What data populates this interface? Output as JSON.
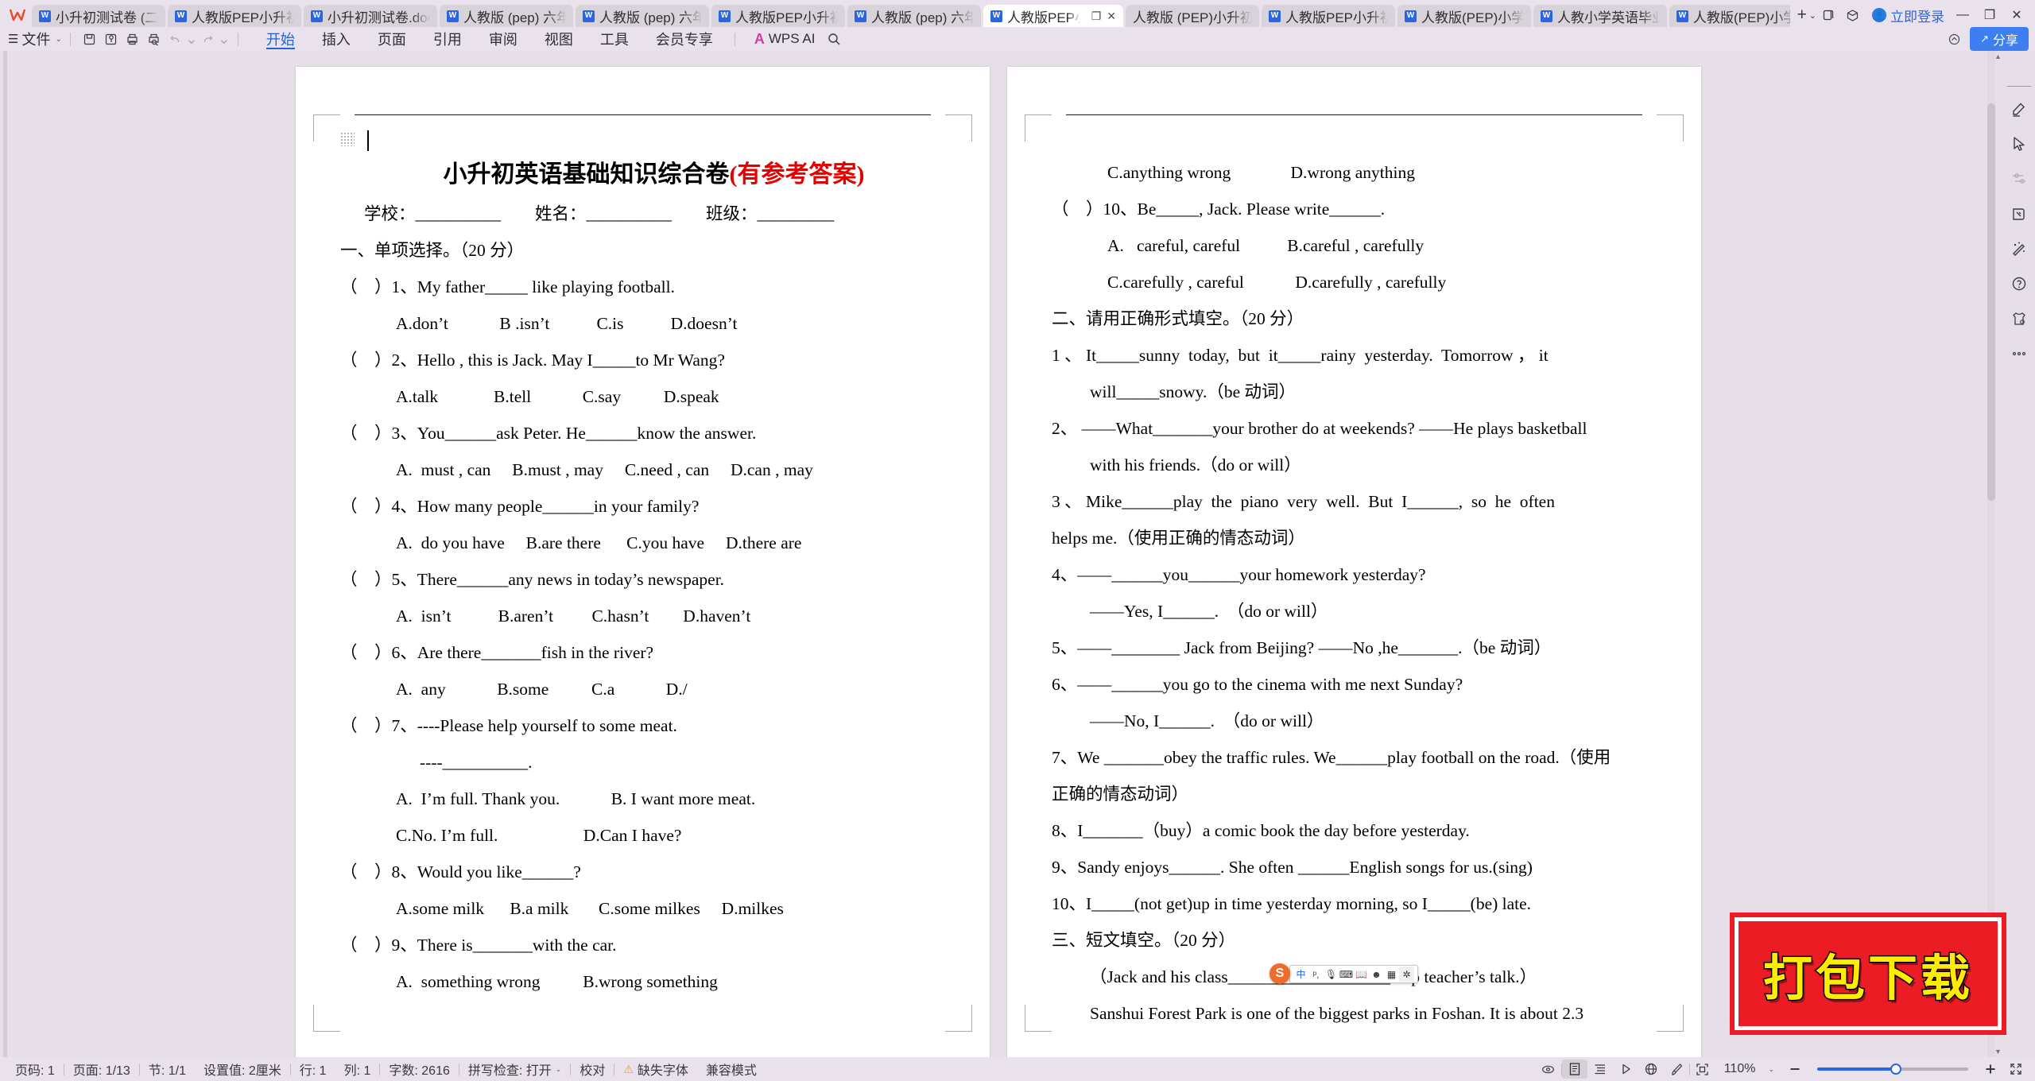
{
  "app": {
    "logo": "wps-logo",
    "login_label": "立即登录",
    "new_tab": "+",
    "window_min": "—",
    "window_max": "❐",
    "window_close": "✕"
  },
  "tabs": [
    {
      "label": "小升初测试卷 (二) .d",
      "active": false
    },
    {
      "label": "人教版PEP小升初英语",
      "active": false
    },
    {
      "label": "小升初测试卷.doc",
      "active": false
    },
    {
      "label": "人教版 (pep) 六年级",
      "active": false
    },
    {
      "label": "人教版 (pep) 六年级",
      "active": false
    },
    {
      "label": "人教版PEP小升初英语",
      "active": false
    },
    {
      "label": "人教版 (pep) 六年级",
      "active": false
    },
    {
      "label": "人教版PEP小升初",
      "active": true
    },
    {
      "label": "人教版 (PEP)小升初-分",
      "active": false
    },
    {
      "label": "人教版PEP小升初英语",
      "active": false
    },
    {
      "label": "人教版(PEP)小学英语小",
      "active": false
    },
    {
      "label": "人教小学英语毕业升学",
      "active": false
    },
    {
      "label": "人教版(PEP)小学英语小",
      "active": false
    }
  ],
  "ribbon": {
    "file_label": "文件",
    "quick_icons": [
      "save-icon",
      "save-as-icon",
      "print-icon",
      "print-preview-icon",
      "undo-icon",
      "redo-icon",
      "customize-caret-icon"
    ],
    "tabs": [
      {
        "label": "开始",
        "active": true
      },
      {
        "label": "插入",
        "active": false
      },
      {
        "label": "页面",
        "active": false
      },
      {
        "label": "引用",
        "active": false
      },
      {
        "label": "审阅",
        "active": false
      },
      {
        "label": "视图",
        "active": false
      },
      {
        "label": "工具",
        "active": false
      },
      {
        "label": "会员专享",
        "active": false
      }
    ],
    "ai_label": "WPS AI",
    "search_icon": "search-icon",
    "share_label": "分享",
    "collapse_icon": "collapse-ribbon-icon"
  },
  "document": {
    "title_black": "小升初英语基础知识综合卷",
    "title_red": "(有参考答案)",
    "header_fields": "学校：__________        姓名：__________        班级：_________",
    "left_page": [
      "一、单项选择。（20 分）",
      "（    ）1、My father_____ like playing football.",
      "A.don’t            B .isn’t           C.is           D.doesn’t",
      "（    ）2、Hello , this is Jack. May I_____to Mr Wang?",
      "A.talk             B.tell            C.say          D.speak",
      "（    ）3、You______ask Peter. He______know the answer.",
      "A.  must , can     B.must , may     C.need , can     D.can , may",
      "（    ）4、How many people______in your family?",
      "A.  do you have     B.are there      C.you have     D.there are",
      "（    ）5、There______any news in today’s newspaper.",
      "A.  isn’t           B.aren’t         C.hasn’t        D.haven’t",
      "（    ）6、Are there_______fish in the river?",
      "A.  any            B.some          C.a            D./",
      "（    ）7、----Please help yourself to some meat.",
      "----__________.",
      "A.  I’m full. Thank you.            B. I want more meat.",
      "C.No. I’m full.                    D.Can I have?",
      "（    ）8、Would you like______?",
      "A.some milk      B.a milk       C.some milkes     D.milkes",
      "（    ）9、There is_______with the car.",
      "A.  something wrong          B.wrong something"
    ],
    "right_page": [
      "C.anything wrong              D.wrong anything",
      "（    ）10、Be_____, Jack. Please write______.",
      "A.   careful, careful           B.careful , carefully",
      "C.carefully , careful            D.carefully , carefully",
      "二、请用正确形式填空。（20 分）",
      "1 、 It_____sunny  today,  but  it_____rainy  yesterday.  Tomorrow ， it",
      "will_____snowy.（be 动词）",
      "2、 ——What_______your brother do at weekends? ——He plays basketball",
      "with his friends.（do or will）",
      "3 、 Mike______play  the  piano  very  well.  But  I______,  so  he  often",
      "helps me.（使用正确的情态动词）",
      "4、——______you______your homework yesterday?",
      "——Yes, I______.　（do or will）",
      "5、——________ Jack from Beijing? ——No ,he_______.（be 动词）",
      "6、——______you go to the cinema with me next Sunday?",
      "——No, I______.　（do or will）",
      "7、We _______obey the traffic rules. We______play football on the road.（使用",
      "正确的情态动词）",
      "8、I_______（buy）a comic book the day before yesterday.",
      "9、Sandy enjoys______. She often ______English songs for us.(sing)",
      "10、I_____(not get)up in time yesterday morning, so I_____(be) late.",
      "三、短文填空。（20 分）",
      "（Jack and his class___________________amp teacher’s talk.）",
      "Sanshui Forest Park is one of the biggest parks in Foshan. It is about 2.3"
    ]
  },
  "floating_toolbar": {
    "badge": "S",
    "items": [
      "中",
      "pinyin-icon",
      "mic-icon",
      "keyboard-icon",
      "book-icon",
      "smiley-icon",
      "grid-icon",
      "gear-icon"
    ]
  },
  "right_rail": {
    "icons": [
      "minus-icon",
      "pen-icon",
      "cursor-select-icon",
      "slider-settings-icon",
      "paint-bucket-icon",
      "magic-wand-icon",
      "help-icon",
      "tshirt-skin-icon",
      "more-icon"
    ]
  },
  "statusbar": {
    "left_items": [
      "页码: 1",
      "页面: 1/13",
      "节: 1/1",
      "设置值: 2厘米",
      "行: 1",
      "列: 1",
      "字数: 2616",
      "拼写检查: 打开",
      "校对",
      "缺失字体",
      "兼容模式"
    ],
    "zoom": "110%",
    "view_icons": [
      "eye-icon",
      "page-view-icon",
      "outline-view-icon",
      "read-view-icon",
      "web-view-icon",
      "brush-icon",
      "focus-icon"
    ]
  },
  "watermark": {
    "text": "打包下载",
    "bg_color": "#ec1c24",
    "text_color": "#ffec00"
  },
  "colors": {
    "accent": "#2b65e0",
    "chrome": "#e9e1ec",
    "workspace": "#e6dfe8",
    "title_red": "#e60000"
  }
}
